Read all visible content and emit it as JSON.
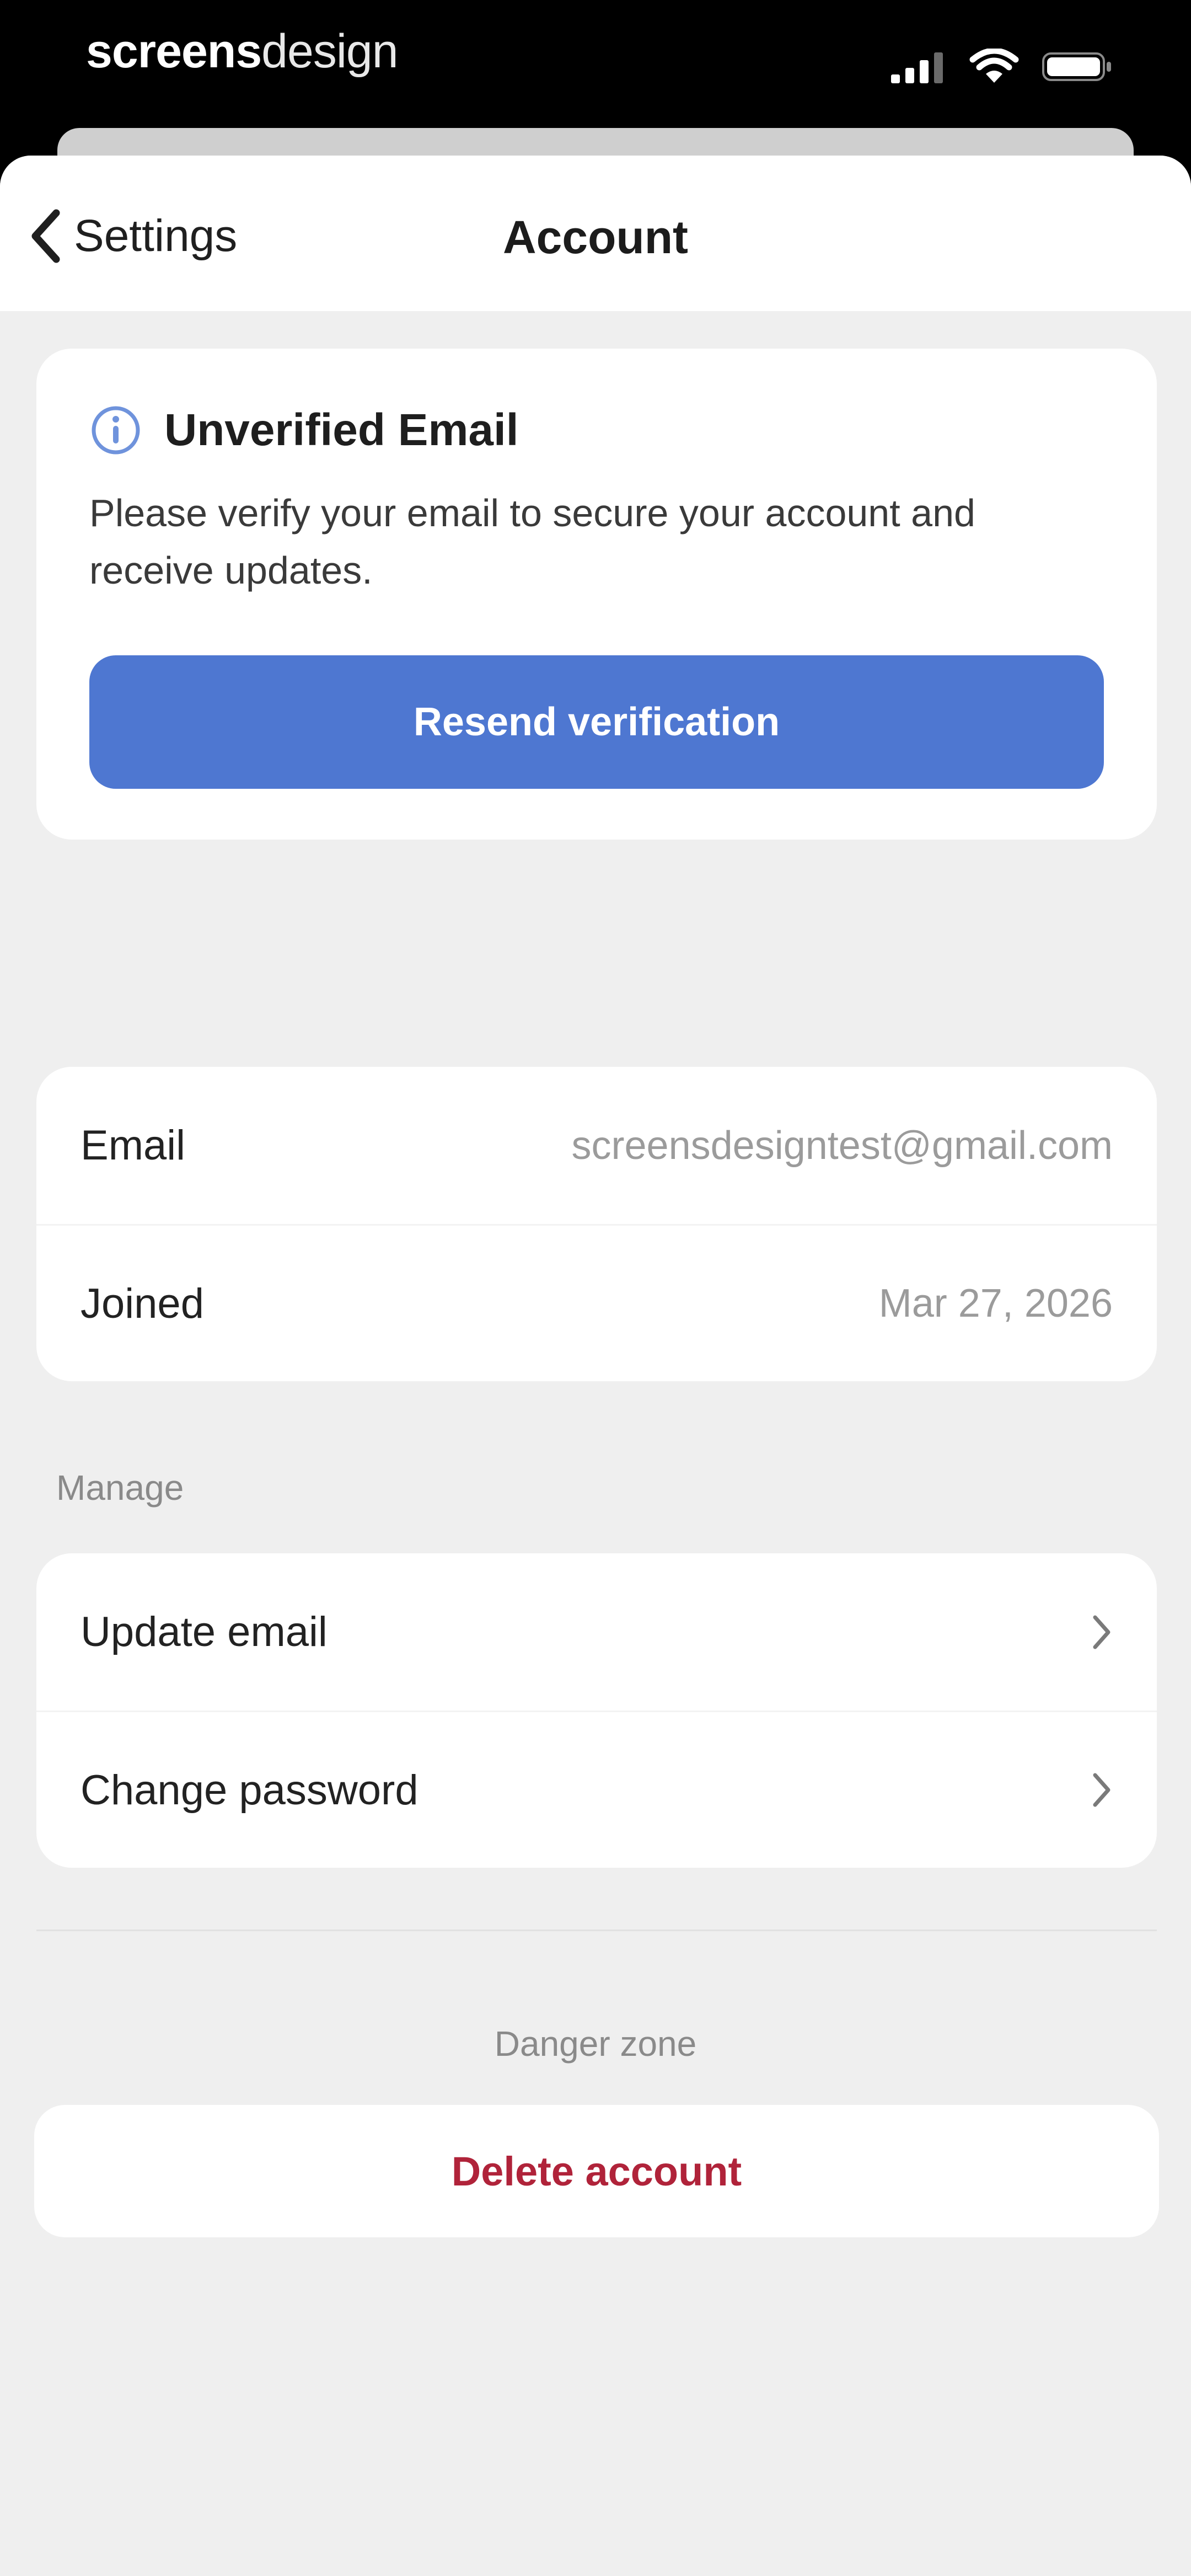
{
  "status_bar": {
    "brand_bold": "screens",
    "brand_light": "design"
  },
  "nav": {
    "back_label": "Settings",
    "title": "Account"
  },
  "verify": {
    "title": "Unverified Email",
    "message": "Please verify your email to secure your account and receive updates.",
    "button_label": "Resend verification",
    "accent_color": "#4e77d1"
  },
  "account_info": {
    "rows": [
      {
        "label": "Email",
        "value": "screensdesigntest@gmail.com"
      },
      {
        "label": "Joined",
        "value": "Mar 27, 2026"
      }
    ]
  },
  "manage": {
    "section_label": "Manage",
    "items": [
      {
        "label": "Update email",
        "icon": "chevron-right-icon"
      },
      {
        "label": "Change password",
        "icon": "chevron-right-icon"
      }
    ]
  },
  "danger": {
    "section_label": "Danger zone",
    "delete_label": "Delete account",
    "color": "#b0233a"
  }
}
